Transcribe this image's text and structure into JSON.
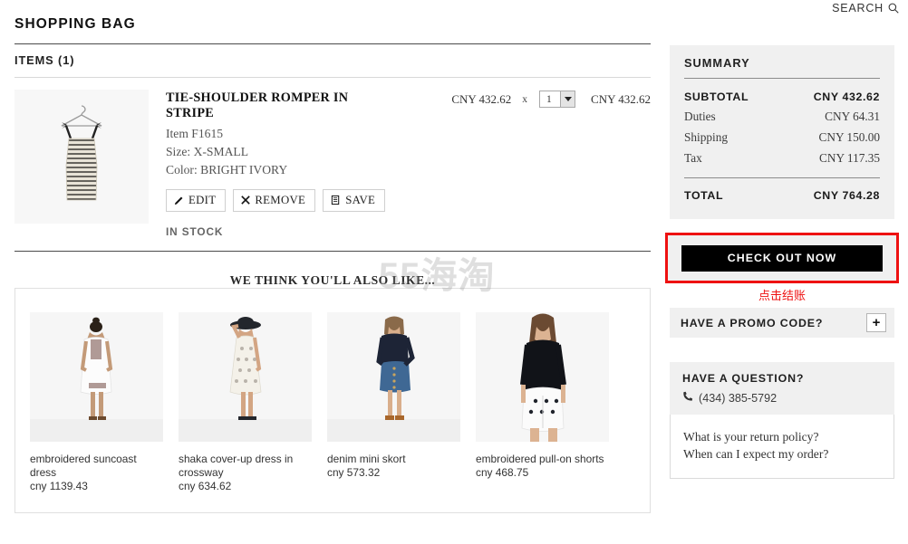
{
  "header": {
    "search_label": "SEARCH",
    "search_icon": "search-icon"
  },
  "page": {
    "title": "SHOPPING BAG",
    "items_count_label": "ITEMS (1)",
    "watermark": "55海淘"
  },
  "cart_item": {
    "name": "TIE-SHOULDER ROMPER IN STRIPE",
    "item_number": "Item F1615",
    "size": "Size: X-SMALL",
    "color": "Color: BRIGHT IVORY",
    "stock_status": "IN STOCK",
    "unit_price": "CNY 432.62",
    "multiply_symbol": "x",
    "quantity": "1",
    "line_total": "CNY 432.62",
    "actions": [
      {
        "label": "EDIT",
        "icon": "pencil-icon"
      },
      {
        "label": "REMOVE",
        "icon": "close-x-icon"
      },
      {
        "label": "SAVE",
        "icon": "save-list-icon"
      }
    ]
  },
  "summary": {
    "title": "SUMMARY",
    "rows": [
      {
        "label": "SUBTOTAL",
        "value": "CNY 432.62",
        "bold": true
      },
      {
        "label": "Duties",
        "value": "CNY 64.31",
        "bold": false
      },
      {
        "label": "Shipping",
        "value": "CNY 150.00",
        "bold": false
      },
      {
        "label": "Tax",
        "value": "CNY 117.35",
        "bold": false
      }
    ],
    "total_label": "TOTAL",
    "total_value": "CNY 764.28"
  },
  "checkout": {
    "button_label": "CHECK OUT NOW",
    "annotation_text": "点击结账",
    "annotation_color": "#ee1111",
    "highlight_color": "#ee1111"
  },
  "promo": {
    "label": "HAVE A PROMO CODE?",
    "expand_symbol": "+"
  },
  "question": {
    "title": "HAVE A QUESTION?",
    "phone": "(434) 385-5792",
    "phone_icon": "phone-icon",
    "links": [
      "What is your return policy?",
      "When can I expect my order?"
    ]
  },
  "recommendations": {
    "title": "WE THINK YOU'LL ALSO LIKE...",
    "products": [
      {
        "name": "embroidered suncoast dress",
        "price": "cny 1139.43"
      },
      {
        "name": "shaka cover-up dress in crossway",
        "price": "cny 634.62"
      },
      {
        "name": "denim mini skort",
        "price": "cny 573.32"
      },
      {
        "name": "embroidered pull-on shorts",
        "price": "cny 468.75"
      }
    ]
  }
}
